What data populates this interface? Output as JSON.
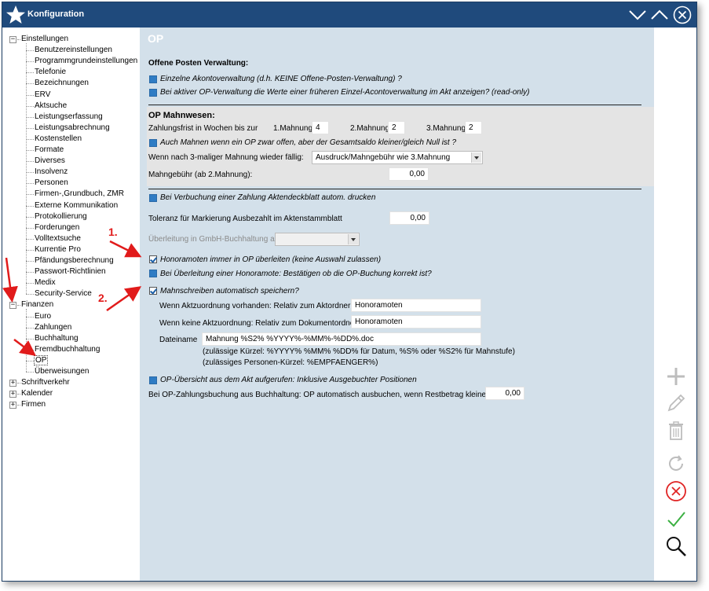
{
  "window": {
    "title": "Konfiguration"
  },
  "tree": {
    "nodes": [
      {
        "label": "Einstellungen",
        "level": 0,
        "expander": "−"
      },
      {
        "label": "Benutzereinstellungen",
        "level": 1
      },
      {
        "label": "Programmgrundeinstellungen",
        "level": 1
      },
      {
        "label": "Telefonie",
        "level": 1
      },
      {
        "label": "Bezeichnungen",
        "level": 1
      },
      {
        "label": "ERV",
        "level": 1
      },
      {
        "label": "Aktsuche",
        "level": 1
      },
      {
        "label": "Leistungserfassung",
        "level": 1
      },
      {
        "label": "Leistungsabrechnung",
        "level": 1
      },
      {
        "label": "Kostenstellen",
        "level": 1
      },
      {
        "label": "Formate",
        "level": 1
      },
      {
        "label": "Diverses",
        "level": 1
      },
      {
        "label": "Insolvenz",
        "level": 1
      },
      {
        "label": "Personen",
        "level": 1
      },
      {
        "label": "Firmen-,Grundbuch, ZMR",
        "level": 1
      },
      {
        "label": "Externe Kommunikation",
        "level": 1
      },
      {
        "label": "Protokollierung",
        "level": 1
      },
      {
        "label": "Forderungen",
        "level": 1
      },
      {
        "label": "Volltextsuche",
        "level": 1
      },
      {
        "label": "Kurrentie Pro",
        "level": 1
      },
      {
        "label": "Pfändungsberechnung",
        "level": 1
      },
      {
        "label": "Passwort-Richtlinien",
        "level": 1
      },
      {
        "label": "Medix",
        "level": 1
      },
      {
        "label": "Security-Service",
        "level": 1
      },
      {
        "label": "Finanzen",
        "level": 0,
        "expander": "−"
      },
      {
        "label": "Euro",
        "level": 1
      },
      {
        "label": "Zahlungen",
        "level": 1
      },
      {
        "label": "Buchhaltung",
        "level": 1
      },
      {
        "label": "Fremdbuchhaltung",
        "level": 1
      },
      {
        "label": "OP",
        "level": 1,
        "selected": true
      },
      {
        "label": "Überweisungen",
        "level": 1
      },
      {
        "label": "Schriftverkehr",
        "level": 0,
        "expander": "+"
      },
      {
        "label": "Kalender",
        "level": 0,
        "expander": "+"
      },
      {
        "label": "Firmen",
        "level": 0,
        "expander": "+"
      }
    ]
  },
  "main": {
    "heading": "OP",
    "section1": {
      "title": "Offene Posten Verwaltung:",
      "cb1": "Einzelne Akontoverwaltung (d.h. KEINE Offene-Posten-Verwaltung) ?",
      "cb2": "Bei aktiver OP-Verwaltung die Werte einer früheren Einzel-Acontoverwaltung im Akt anzeigen? (read-only)"
    },
    "mahnwesen": {
      "title": "OP Mahnwesen:",
      "frist_label": "Zahlungsfrist in Wochen bis zur",
      "m1_label": "1.Mahnung",
      "m1_value": "4",
      "m2_label": "2.Mahnung",
      "m2_value": "2",
      "m3_label": "3.Mahnung",
      "m3_value": "2",
      "cb_saldo": "Auch Mahnen wenn ein OP zwar offen, aber der Gesamtsaldo kleiner/gleich Null ist ?",
      "faellig_label": "Wenn nach 3-maliger Mahnung wieder fällig:",
      "faellig_value": "Ausdruck/Mahngebühr wie 3.Mahnung",
      "gebuehr_label": "Mahngebühr (ab 2.Mahnung):",
      "gebuehr_value": "0,00"
    },
    "cb_deckblatt": "Bei Verbuchung einer Zahlung Aktendeckblatt autom. drucken",
    "toleranz_label": "Toleranz für Markierung Ausbezahlt im Aktenstammblatt",
    "toleranz_value": "0,00",
    "ueberleitung_label": "Überleitung in GmbH-Buchhaltung ab",
    "ueberleitung_value": "",
    "cb_honorar1": "Honoramoten immer in OP überleiten (keine Auswahl zulassen)",
    "cb_honorar2": "Bei Überleitung einer Honoramote: Bestätigen ob die OP-Buchung korrekt ist?",
    "cb_mahnschreiben": "Mahnschreiben automatisch speichern?",
    "aktzuordnung_label": "Wenn Aktzuordnung vorhanden: Relativ zum Aktordner",
    "aktzuordnung_value": "Honoramoten",
    "keine_aktzuordnung_label": "Wenn keine Aktzuordnung: Relativ zum Dokumentordner",
    "keine_aktzuordnung_value": "Honoramoten",
    "dateiname_label": "Dateiname",
    "dateiname_value": "Mahnung %S2% %YYYY%-%MM%-%DD%.doc",
    "kuerzel_hint1": "(zulässige Kürzel: %YYYY% %MM% %DD% für Datum,  %S% oder %S2% für Mahnstufe)",
    "kuerzel_hint2": "(zulässiges Personen-Kürzel: %EMPFAENGER%)",
    "cb_uebersicht": "OP-Übersicht aus dem Akt aufgerufen: Inklusive Ausgebuchter Positionen",
    "restbetrag_label": "Bei OP-Zahlungsbuchung aus Buchhaltung: OP automatisch ausbuchen, wenn Restbetrag kleiner als",
    "restbetrag_value": "0,00"
  },
  "annotations": {
    "a1": "1.",
    "a2": "2."
  },
  "colors": {
    "titlebar": "#1f4a7c",
    "panel": "#d3e0ea",
    "checkbox": "#2f7cc4",
    "annotation": "#e11b1b"
  }
}
